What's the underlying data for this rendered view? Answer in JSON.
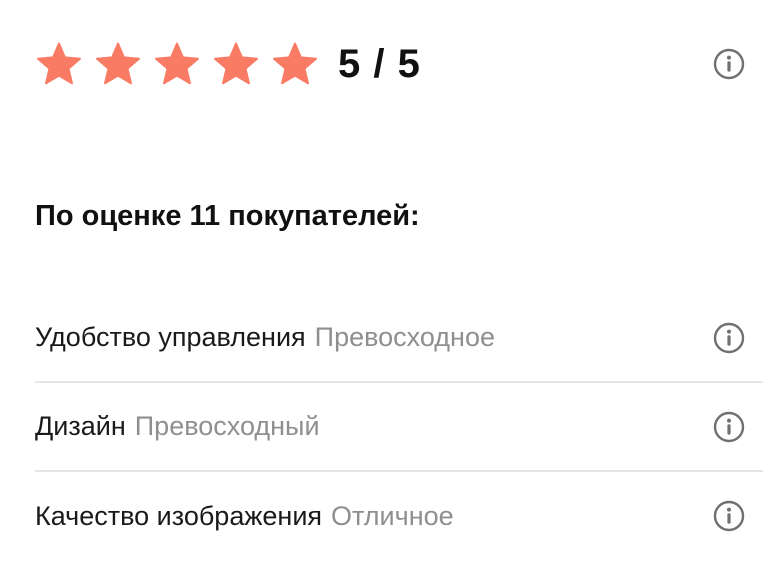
{
  "rating": {
    "value": 5,
    "max": 5,
    "display": "5 / 5",
    "star_color": "#F97B64",
    "info_icon": "info-icon"
  },
  "summary": {
    "title": "По оценке 11 покупателей:"
  },
  "criteria": [
    {
      "name": "Удобство управления",
      "grade": "Превосходное",
      "info_icon": "info-icon"
    },
    {
      "name": "Дизайн",
      "grade": "Превосходный",
      "info_icon": "info-icon"
    },
    {
      "name": "Качество изображения",
      "grade": "Отличное",
      "info_icon": "info-icon"
    }
  ],
  "colors": {
    "text": "#111111",
    "muted": "#8D8F91",
    "divider": "#E5E5E5",
    "icon": "#6E7073"
  }
}
